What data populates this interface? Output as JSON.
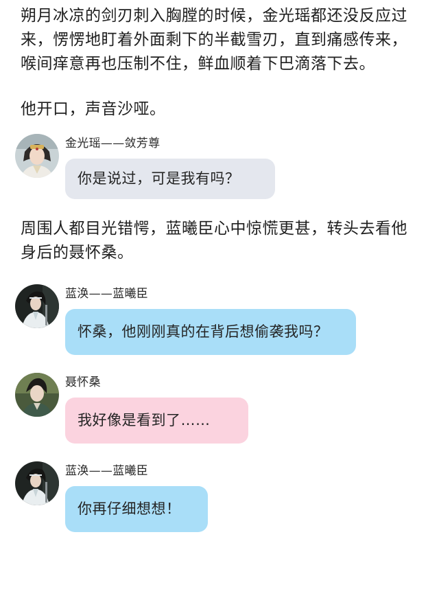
{
  "narration": {
    "p1": "朔月冰凉的剑刃刺入胸膛的时候，金光瑶都还没反应过来，愣愣地盯着外面剩下的半截雪刃，直到痛感传来，喉间痒意再也压制不住，鲜血顺着下巴滴落下去。",
    "p2": "他开口，声音沙哑。",
    "p3": "周围人都目光错愕，蓝曦臣心中惊慌更甚，转头去看他身后的聂怀桑。"
  },
  "messages": [
    {
      "speaker": "金光瑶——敛芳尊",
      "text": "你是说过，可是我有吗？",
      "bubble_color": "#e4e7ee",
      "avatar_icon": "jin-guangyao-avatar"
    },
    {
      "speaker": "蓝涣——蓝曦臣",
      "text": "怀桑，他刚刚真的在背后想偷袭我吗？",
      "bubble_color": "#a9def8",
      "avatar_icon": "lan-xichen-avatar"
    },
    {
      "speaker": "聂怀桑",
      "text": "我好像是看到了……",
      "bubble_color": "#fbd3df",
      "avatar_icon": "nie-huaisang-avatar"
    },
    {
      "speaker": "蓝涣——蓝曦臣",
      "text": "你再仔细想想！",
      "bubble_color": "#a9def8",
      "avatar_icon": "lan-xichen-avatar"
    }
  ]
}
